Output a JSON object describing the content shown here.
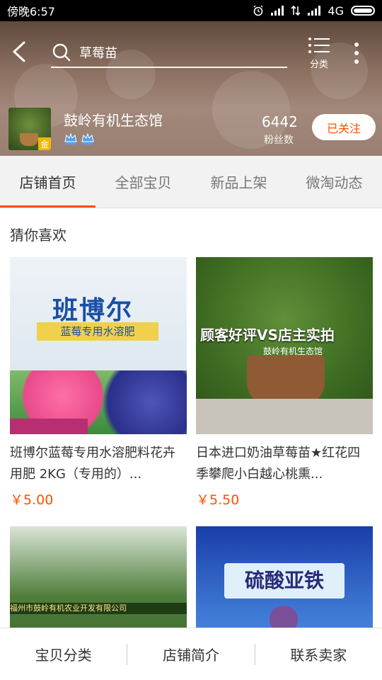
{
  "status_bar": {
    "time": "傍晚6:57",
    "network": "4G"
  },
  "header": {
    "search_query": "草莓苗",
    "category_label": "分类",
    "store_name": "鼓岭有机生态馆",
    "store_badge": "金",
    "fans_count": "6442",
    "fans_label": "粉丝数",
    "follow_label": "已关注"
  },
  "tabs": [
    {
      "label": "店铺首页",
      "active": true
    },
    {
      "label": "全部宝贝",
      "active": false
    },
    {
      "label": "新品上架",
      "active": false
    },
    {
      "label": "微淘动态",
      "active": false
    }
  ],
  "content": {
    "section_title": "猜你喜欢",
    "products": [
      {
        "title": "班博尔蓝莓专用水溶肥料花卉用肥 2KG（专用的）...",
        "price": "￥5.00",
        "image_text": {
          "brand": "班博尔",
          "band": "蓝莓专用水溶肥"
        }
      },
      {
        "title": "日本进口奶油草莓苗★红花四季攀爬小白越心桃熏...",
        "price": "￥5.50",
        "image_text": {
          "overlay": "顾客好评VS店主实拍",
          "sub": "鼓岭有机生态馆"
        }
      },
      {
        "title": "",
        "price": "",
        "image_text": {
          "stripe": "福州市鼓岭有机农业开发有限公司"
        }
      },
      {
        "title": "",
        "price": "",
        "image_text": {
          "label": "硫酸亚铁"
        }
      }
    ]
  },
  "bottom_nav": [
    {
      "label": "宝贝分类"
    },
    {
      "label": "店铺简介"
    },
    {
      "label": "联系卖家"
    }
  ],
  "colors": {
    "accent": "#ff5000",
    "header_bg": "#8a6e5e",
    "crown": "#4aa3ff"
  }
}
